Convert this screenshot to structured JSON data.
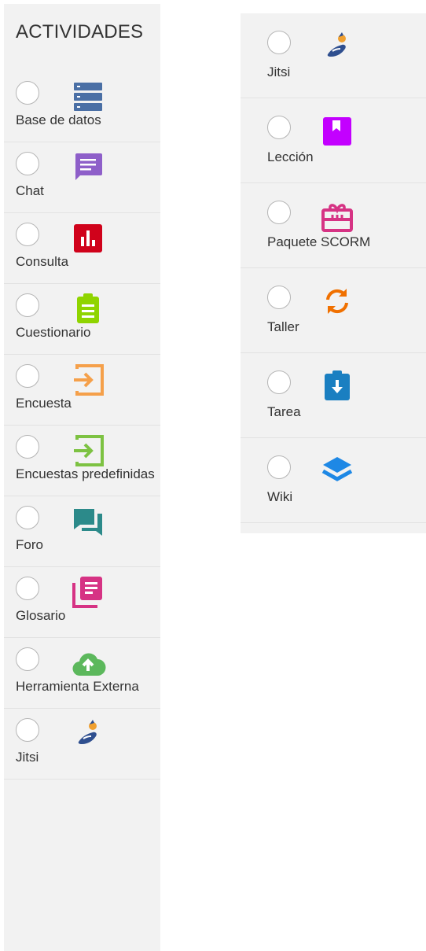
{
  "left_panel": {
    "title": "ACTIVIDADES",
    "items": [
      {
        "label": "Base de datos",
        "icon": "database-icon",
        "color": "#4a6fa5"
      },
      {
        "label": "Chat",
        "icon": "chat-icon",
        "color": "#8e5fc9"
      },
      {
        "label": "Consulta",
        "icon": "bar-chart-icon",
        "color": "#d0021b"
      },
      {
        "label": "Cuestionario",
        "icon": "clipboard-list-icon",
        "color": "#8fd400"
      },
      {
        "label": "Encuesta",
        "icon": "enter-arrow-icon",
        "color": "#f5a04a"
      },
      {
        "label": "Encuestas predefinidas",
        "icon": "enter-arrow-icon",
        "color": "#7dc242"
      },
      {
        "label": "Foro",
        "icon": "forum-icon",
        "color": "#2c8a8a"
      },
      {
        "label": "Glosario",
        "icon": "glossary-icon",
        "color": "#d63384"
      },
      {
        "label": "Herramienta Externa",
        "icon": "cloud-upload-icon",
        "color": "#5cb85c"
      },
      {
        "label": "Jitsi",
        "icon": "jitsi-icon",
        "color": "#2f4f8f"
      }
    ]
  },
  "right_panel": {
    "items": [
      {
        "label": "Jitsi",
        "icon": "jitsi-icon",
        "color": "#2f4f8f"
      },
      {
        "label": "Lección",
        "icon": "bookmark-icon",
        "color": "#c300ff"
      },
      {
        "label": "Paquete SCORM",
        "icon": "package-icon",
        "color": "#d63384"
      },
      {
        "label": "Taller",
        "icon": "refresh-icon",
        "color": "#f07000"
      },
      {
        "label": "Tarea",
        "icon": "assignment-download-icon",
        "color": "#1a7fc1"
      },
      {
        "label": "Wiki",
        "icon": "layers-icon",
        "color": "#1e88e5"
      }
    ]
  }
}
